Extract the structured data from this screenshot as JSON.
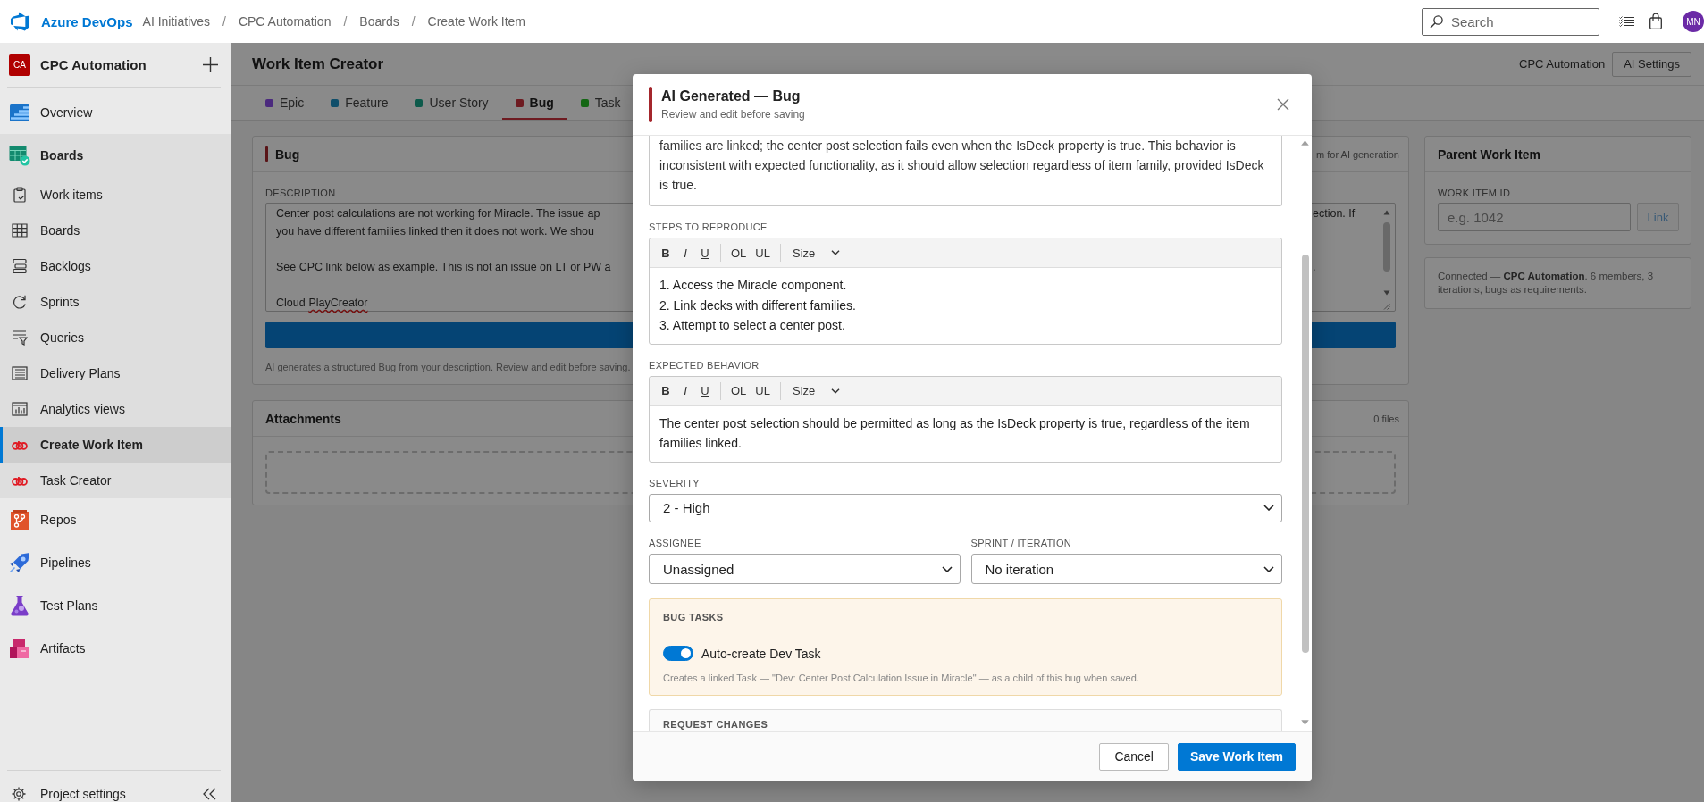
{
  "top_bar": {
    "brand": "Azure DevOps",
    "breadcrumbs": [
      {
        "label": "AI Initiatives"
      },
      {
        "separator": "/",
        "label": "CPC Automation"
      },
      {
        "separator": "/",
        "label": "Boards"
      },
      {
        "separator": "/",
        "label": "Create Work Item"
      }
    ],
    "search": {
      "placeholder": "Search"
    },
    "avatar": {
      "initials": "MN"
    }
  },
  "sidebar": {
    "project": {
      "initials": "CA",
      "name": "CPC Automation"
    },
    "items": [
      {
        "label": "Overview",
        "selected": false,
        "expanded": false
      },
      {
        "label": "Boards",
        "selected": true,
        "expanded": true,
        "children": [
          {
            "label": "Work items",
            "selected": false
          },
          {
            "label": "Boards",
            "selected": false
          },
          {
            "label": "Backlogs",
            "selected": false
          },
          {
            "label": "Sprints",
            "selected": false
          },
          {
            "label": "Queries",
            "selected": false
          },
          {
            "label": "Delivery Plans",
            "selected": false
          },
          {
            "label": "Analytics views",
            "selected": false
          },
          {
            "label": "Create Work Item",
            "selected": true
          },
          {
            "label": "Task Creator",
            "selected": false
          }
        ]
      },
      {
        "label": "Repos",
        "selected": false,
        "expanded": false
      },
      {
        "label": "Pipelines",
        "selected": false,
        "expanded": false
      },
      {
        "label": "Test Plans",
        "selected": false,
        "expanded": false
      },
      {
        "label": "Artifacts",
        "selected": false,
        "expanded": false
      }
    ],
    "footer": {
      "label": "Project settings"
    }
  },
  "page": {
    "title": "Work Item Creator",
    "project": "CPC Automation",
    "settings_button": "AI Settings",
    "tabs": [
      {
        "label": "Epic",
        "color": "#4b2a7e",
        "selected": false
      },
      {
        "label": "Feature",
        "color": "#0f4e6a",
        "selected": false
      },
      {
        "label": "User Story",
        "color": "#0d5a4b",
        "selected": false
      },
      {
        "label": "Bug",
        "color": "#6e1b21",
        "selected": true
      },
      {
        "label": "Task",
        "color": "#136613",
        "selected": false
      }
    ],
    "bug_card": {
      "title": "Bug",
      "hint": "m for AI generation",
      "description": {
        "label": "DESCRIPTION",
        "paragraphs": [
          {
            "lines": [
              {
                "left": "Center post calculations are not working for Miracle. The issue ap",
                "right": "ection. If"
              },
              {
                "left": "you have different families linked then it does not work. We shou"
              }
            ]
          },
          {
            "lines": [
              {
                "left": "See CPC link below as example. This is not an issue on LT or PW a",
                "right": "."
              }
            ]
          },
          {
            "lines": [
              {
                "left": "Cloud",
                "misspelled": "PlayCreator"
              }
            ]
          }
        ]
      },
      "note": "AI generates a structured Bug from your description. Review and edit before saving."
    },
    "attachments": {
      "title": "Attachments",
      "count": "0 files"
    },
    "parent_card": {
      "title": "Parent Work Item",
      "field": {
        "label": "WORK ITEM ID",
        "placeholder": "e.g. 1042"
      },
      "link": {
        "label": "Link",
        "disabled": true
      }
    },
    "info": {
      "text": "Connected — **CPC Automation**. 6 members, 3 iterations, bugs as requirements."
    }
  },
  "modal": {
    "title": "AI Generated — Bug",
    "subtitle": "Review and edit before saving",
    "summary_tail": "families are linked; the center post selection fails even when the IsDeck property is true. This behavior is inconsistent with expected functionality, as it should allow selection regardless of item family, provided IsDeck is true.",
    "editors": [
      {
        "label": "STEPS TO REPRODUCE",
        "toolbar": [
          [
            {
              "label": "B",
              "kind": "bold"
            },
            {
              "label": "I",
              "kind": "italic"
            },
            {
              "label": "U",
              "kind": "underline"
            }
          ],
          [
            {
              "label": "OL",
              "kind": "plain"
            },
            {
              "label": "UL",
              "kind": "plain"
            }
          ],
          [
            {
              "label": "Size",
              "kind": "dropdown"
            }
          ]
        ],
        "lines": [
          "1. Access the Miracle component.",
          "2. Link decks with different families.",
          "3. Attempt to select a center post."
        ]
      },
      {
        "label": "EXPECTED BEHAVIOR",
        "toolbar": [
          [
            {
              "label": "B",
              "kind": "bold"
            },
            {
              "label": "I",
              "kind": "italic"
            },
            {
              "label": "U",
              "kind": "underline"
            }
          ],
          [
            {
              "label": "OL",
              "kind": "plain"
            },
            {
              "label": "UL",
              "kind": "plain"
            }
          ],
          [
            {
              "label": "Size",
              "kind": "dropdown"
            }
          ]
        ],
        "lines": [
          "The center post selection should be permitted as long as the IsDeck property is true, regardless of the item families linked."
        ]
      }
    ],
    "severity": {
      "label": "SEVERITY",
      "value": "2 - High"
    },
    "assignee": {
      "label": "ASSIGNEE",
      "value": "Unassigned"
    },
    "sprint": {
      "label": "SPRINT / ITERATION",
      "value": "No iteration"
    },
    "bug_tasks": {
      "title": "BUG TASKS",
      "toggle": {
        "label": "Auto-create Dev Task",
        "on": true
      },
      "note": "Creates a linked Task — \"Dev: Center Post Calculation Issue in Miracle\" — as a child of this bug when saved."
    },
    "request_changes": {
      "title": "REQUEST CHANGES"
    },
    "buttons": [
      {
        "label": "Cancel",
        "kind": "secondary"
      },
      {
        "label": "Save Work Item",
        "kind": "primary"
      }
    ]
  }
}
